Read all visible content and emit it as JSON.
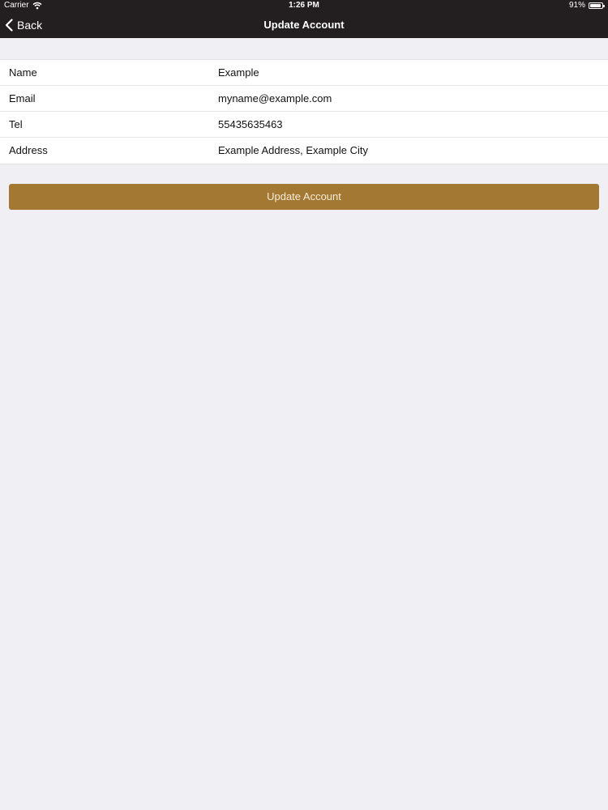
{
  "status_bar": {
    "carrier": "Carrier",
    "time": "1:26 PM",
    "battery_percent": "91%",
    "battery_level": 0.91
  },
  "nav": {
    "back_label": "Back",
    "title": "Update Account"
  },
  "form": {
    "rows": [
      {
        "label": "Name",
        "value": "Example"
      },
      {
        "label": "Email",
        "value": "myname@example.com"
      },
      {
        "label": "Tel",
        "value": "55435635463"
      },
      {
        "label": "Address",
        "value": "Example Address, Example City"
      }
    ]
  },
  "actions": {
    "update_label": "Update Account"
  },
  "colors": {
    "nav_background": "#231f20",
    "page_background": "#efeff4",
    "button_background": "#a37832"
  },
  "icons": {
    "back": "chevron-left-icon",
    "wifi": "wifi-icon",
    "battery": "battery-icon"
  }
}
